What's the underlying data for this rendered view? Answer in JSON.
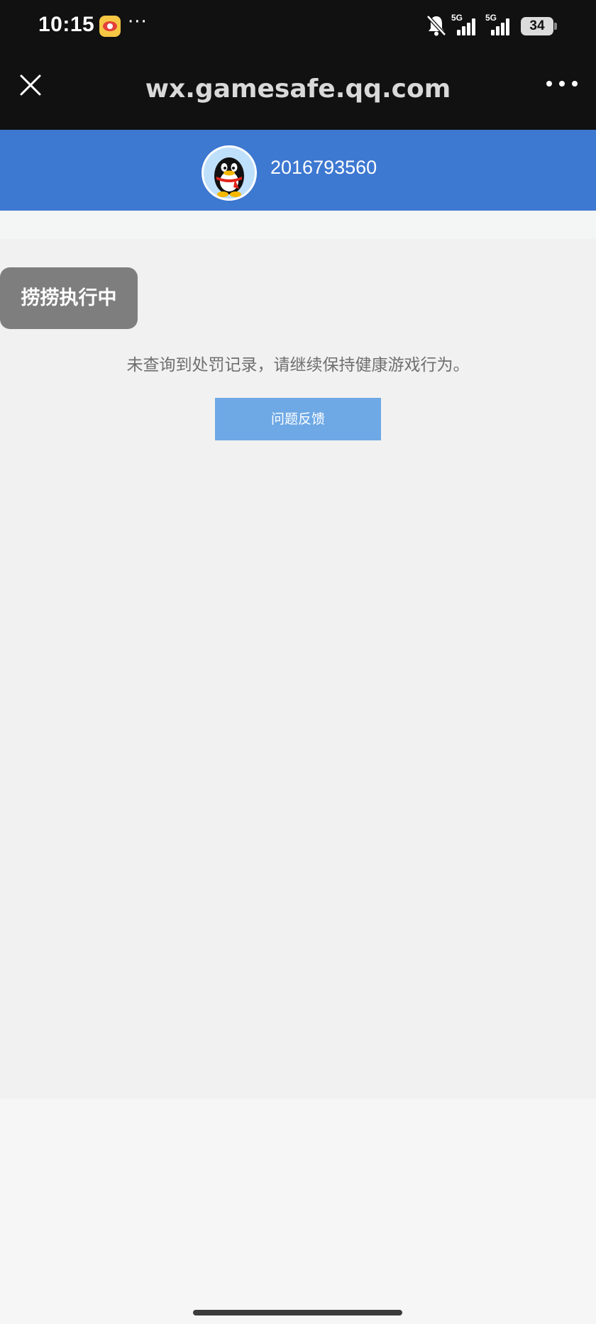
{
  "status_bar": {
    "time": "10:15",
    "more": "···",
    "network_1": "5G",
    "network_2": "5G",
    "battery": "34"
  },
  "title_bar": {
    "url": "wx.gamesafe.qq.com",
    "close_icon": "close-icon",
    "menu_icon": "more-dots-icon"
  },
  "header": {
    "qq_number": "2016793560",
    "avatar_icon": "qq-penguin-icon"
  },
  "content": {
    "status_chip": "捞捞执行中",
    "message": "未查询到处罚记录，请继续保持健康游戏行为。",
    "feedback_label": "问题反馈"
  },
  "colors": {
    "header_blue": "#3d78d1",
    "button_blue": "#6ea9e6",
    "chip_gray": "#7e7e7e",
    "dark_bar": "#111111"
  }
}
